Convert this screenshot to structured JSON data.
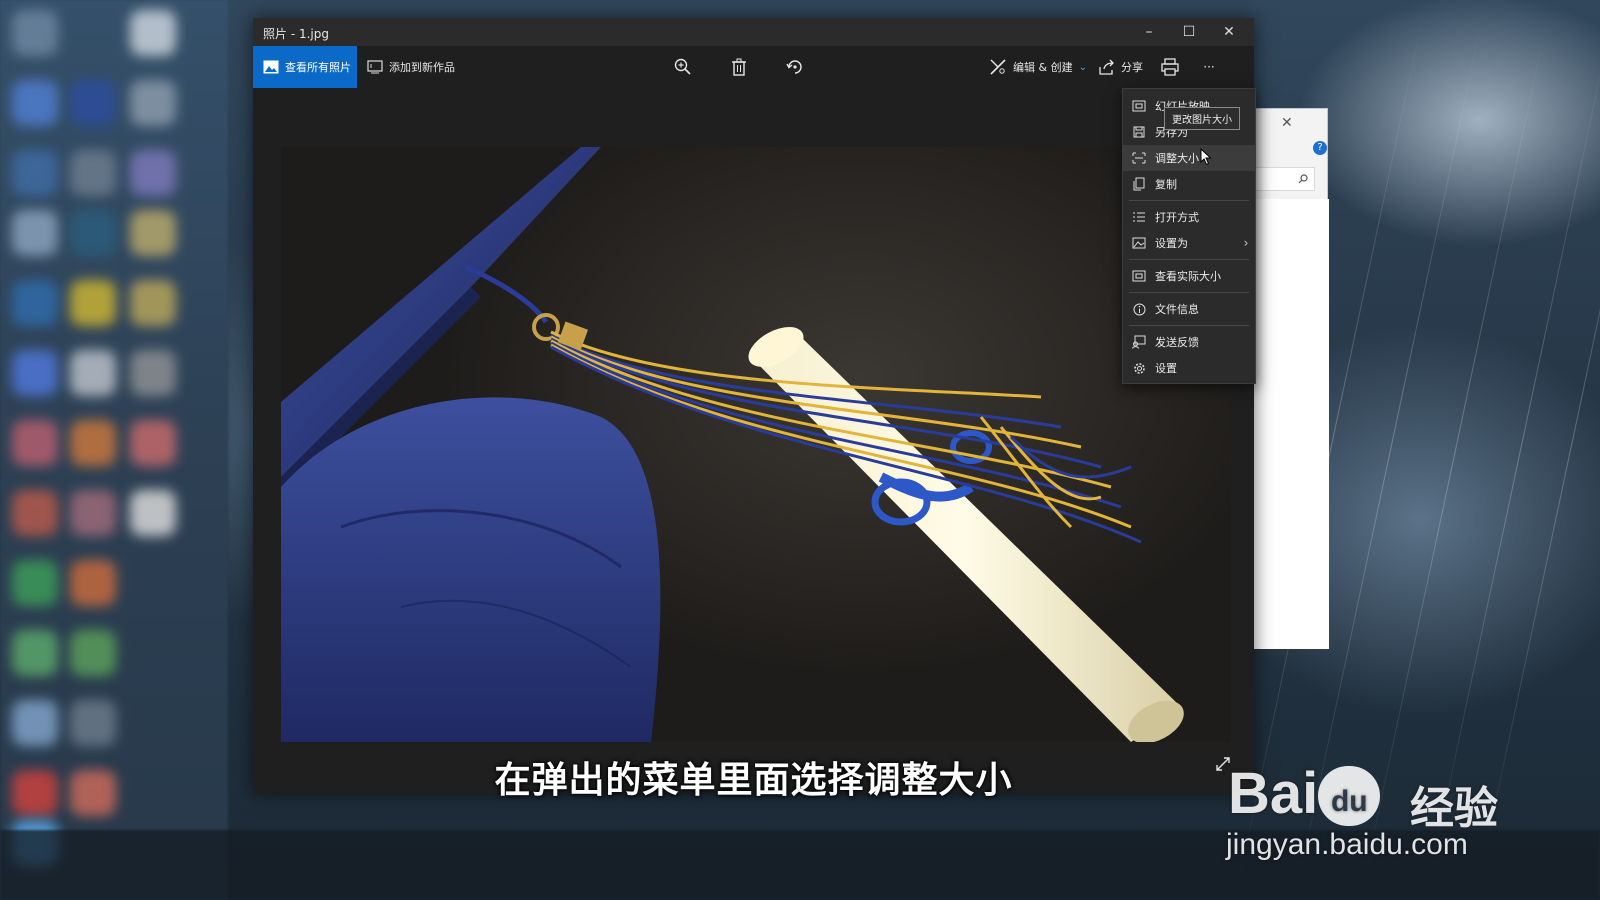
{
  "window": {
    "title": "照片 - 1.jpg",
    "controls": {
      "minimize": "–",
      "maximize": "☐",
      "close": "✕"
    }
  },
  "toolbar": {
    "view_all_label": "查看所有照片",
    "add_to_creation_label": "添加到新作品",
    "edit_create_label": "编辑 & 创建",
    "share_label": "分享",
    "more_label": "···"
  },
  "menu": {
    "items": [
      {
        "label": "幻灯片放映",
        "icon": "slideshow-icon"
      },
      {
        "label": "另存为",
        "icon": "save-icon"
      },
      {
        "label": "调整大小",
        "icon": "resize-icon",
        "hovered": true
      },
      {
        "label": "复制",
        "icon": "copy-icon"
      },
      {
        "label": "打开方式",
        "icon": "open-with-icon"
      },
      {
        "label": "设置为",
        "icon": "set-as-icon",
        "submenu": true
      },
      {
        "label": "查看实际大小",
        "icon": "actual-size-icon"
      },
      {
        "label": "文件信息",
        "icon": "info-icon"
      },
      {
        "label": "发送反馈",
        "icon": "feedback-icon"
      },
      {
        "label": "设置",
        "icon": "settings-icon"
      }
    ],
    "tooltip": "更改图片大小",
    "submenu_arrow": "›"
  },
  "caption": "在弹出的菜单里面选择调整大小",
  "watermark": {
    "brand": "Bai",
    "brand_du": "du",
    "brand_cn": "经验",
    "url": "jingyan.baidu.com"
  },
  "colors": {
    "accent": "#0b69c7",
    "menu_bg": "#2b2b2b",
    "window_bg": "#1f1f1f",
    "cap_blue": "#2f3f86",
    "tassel_gold": "#e2b43a"
  }
}
